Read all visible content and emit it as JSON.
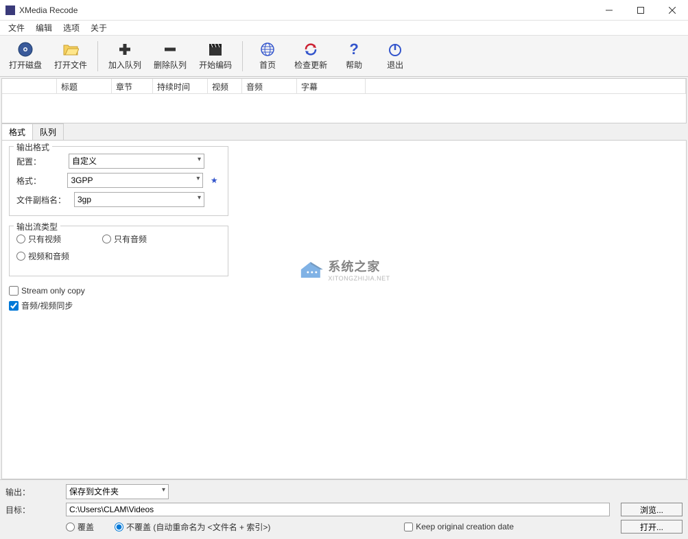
{
  "titlebar": {
    "title": "XMedia Recode"
  },
  "menubar": {
    "items": [
      "文件",
      "编辑",
      "选项",
      "关于"
    ]
  },
  "toolbar": {
    "buttons": [
      {
        "name": "open-disc",
        "label": "打开磁盘",
        "icon": "disc",
        "color": "#1a4a8a"
      },
      {
        "name": "open-file",
        "label": "打开文件",
        "icon": "folder",
        "color": "#e6b800"
      },
      {
        "name": "add-queue",
        "label": "加入队列",
        "icon": "plus",
        "color": "#333"
      },
      {
        "name": "remove-queue",
        "label": "删除队列",
        "icon": "minus",
        "color": "#333"
      },
      {
        "name": "start-encode",
        "label": "开始编码",
        "icon": "clapperboard",
        "color": "#333"
      },
      {
        "name": "homepage",
        "label": "首页",
        "icon": "globe",
        "color": "#3355cc"
      },
      {
        "name": "check-update",
        "label": "检查更新",
        "icon": "refresh",
        "color": "#3355cc"
      },
      {
        "name": "help",
        "label": "帮助",
        "icon": "question",
        "color": "#3355cc"
      },
      {
        "name": "exit",
        "label": "退出",
        "icon": "power",
        "color": "#3355cc"
      }
    ]
  },
  "table": {
    "columns": [
      "",
      "标题",
      "章节",
      "持续时间",
      "视频",
      "音频",
      "字幕"
    ],
    "widths": [
      80,
      80,
      60,
      80,
      50,
      80,
      100
    ]
  },
  "tabs": {
    "items": [
      "格式",
      "队列"
    ],
    "active": 0
  },
  "format_group": {
    "title": "输出格式",
    "config_label": "配置：",
    "config_value": "自定义",
    "format_label": "格式：",
    "format_value": "3GPP",
    "ext_label": "文件副档名：",
    "ext_value": "3gp"
  },
  "stream_group": {
    "title": "输出流类型",
    "video_only": "只有视频",
    "audio_only": "只有音频",
    "video_audio": "视频和音频"
  },
  "checks": {
    "stream_copy": "Stream only copy",
    "av_sync": "音频/视频同步"
  },
  "watermark": {
    "main": "系统之家",
    "sub": "XITONGZHIJIA.NET"
  },
  "bottom": {
    "output_label": "输出：",
    "output_value": "保存到文件夹",
    "target_label": "目标：",
    "target_value": "C:\\Users\\CLAM\\Videos",
    "browse": "浏览...",
    "open": "打开...",
    "overwrite": "覆盖",
    "no_overwrite": "不覆盖 (自动重命名为 <文件名 + 索引>)",
    "keep_date": "Keep original creation date"
  }
}
